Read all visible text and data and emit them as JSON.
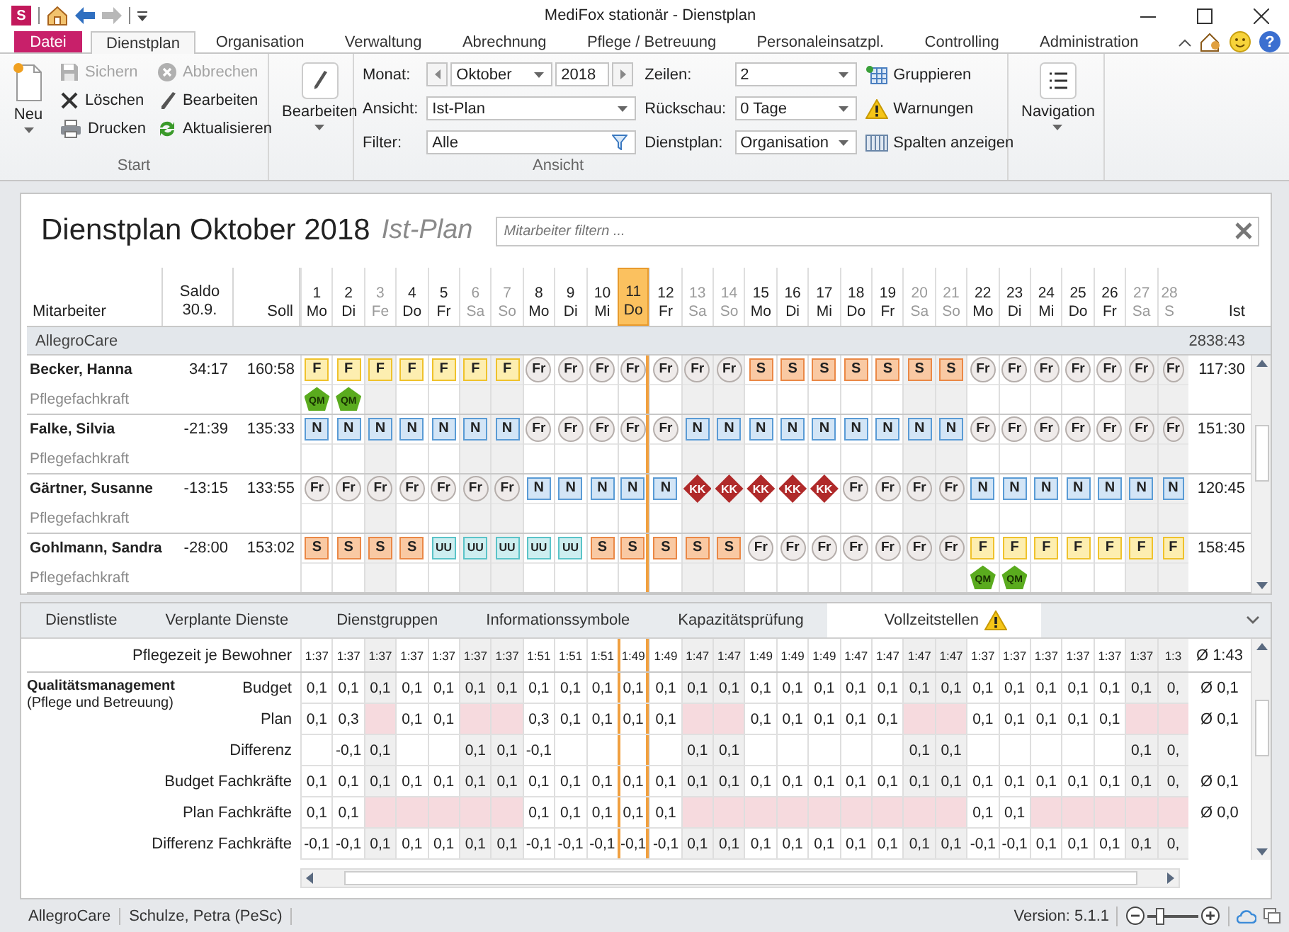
{
  "window": {
    "logo": "S",
    "title": "MediFox stationär - Dienstplan",
    "help": "?"
  },
  "ribbon_tabs": [
    {
      "label": "Datei",
      "kind": "file",
      "selected": false
    },
    {
      "label": "Dienstplan",
      "kind": "tab",
      "selected": true
    },
    {
      "label": "Organisation",
      "kind": "tab",
      "selected": false
    },
    {
      "label": "Verwaltung",
      "kind": "tab",
      "selected": false
    },
    {
      "label": "Abrechnung",
      "kind": "tab",
      "selected": false
    },
    {
      "label": "Pflege / Betreuung",
      "kind": "tab",
      "selected": false
    },
    {
      "label": "Personaleinsatzpl.",
      "kind": "tab",
      "selected": false
    },
    {
      "label": "Controlling",
      "kind": "tab",
      "selected": false
    },
    {
      "label": "Administration",
      "kind": "tab",
      "selected": false
    }
  ],
  "ribbon": {
    "start": {
      "label": "Start",
      "new": "Neu",
      "actions": [
        {
          "label": "Sichern",
          "kind": "save",
          "disabled": true
        },
        {
          "label": "Löschen",
          "kind": "delete",
          "disabled": false
        },
        {
          "label": "Drucken",
          "kind": "print",
          "disabled": false
        },
        {
          "label": "Abbrechen",
          "kind": "cancel",
          "disabled": true
        },
        {
          "label": "Bearbeiten",
          "kind": "edit",
          "disabled": false
        },
        {
          "label": "Aktualisieren",
          "kind": "refresh",
          "disabled": false
        }
      ]
    },
    "edit": {
      "label": "Bearbeiten"
    },
    "view": {
      "label": "Ansicht",
      "month_label": "Monat:",
      "month": "Oktober",
      "year": "2018",
      "view_label": "Ansicht:",
      "view_value": "Ist-Plan",
      "filter_label": "Filter:",
      "filter_value": "Alle",
      "rows_label": "Zeilen:",
      "rows_value": "2",
      "lookback_label": "Rückschau:",
      "lookback_value": "0 Tage",
      "plan_label": "Dienstplan:",
      "plan_value": "Organisation",
      "actions": [
        {
          "label": "Gruppieren",
          "kind": "group"
        },
        {
          "label": "Warnungen",
          "kind": "warning"
        },
        {
          "label": "Spalten anzeigen",
          "kind": "columns"
        }
      ]
    },
    "navigation": {
      "label": "Navigation"
    }
  },
  "plan": {
    "title": "Dienstplan Oktober 2018",
    "subtitle": "Ist-Plan",
    "filter_placeholder": "Mitarbeiter filtern ...",
    "employee_header": "Mitarbeiter",
    "saldo_header": "Saldo 30.9.",
    "soll_header": "Soll",
    "ist_header": "Ist",
    "days": [
      {
        "day": "1",
        "weekday": "Mo",
        "muted": false,
        "selected": false
      },
      {
        "day": "2",
        "weekday": "Di",
        "muted": false,
        "selected": false
      },
      {
        "day": "3",
        "weekday": "Fe",
        "muted": true,
        "selected": false
      },
      {
        "day": "4",
        "weekday": "Do",
        "muted": false,
        "selected": false
      },
      {
        "day": "5",
        "weekday": "Fr",
        "muted": false,
        "selected": false
      },
      {
        "day": "6",
        "weekday": "Sa",
        "muted": true,
        "selected": false
      },
      {
        "day": "7",
        "weekday": "So",
        "muted": true,
        "selected": false
      },
      {
        "day": "8",
        "weekday": "Mo",
        "muted": false,
        "selected": false
      },
      {
        "day": "9",
        "weekday": "Di",
        "muted": false,
        "selected": false
      },
      {
        "day": "10",
        "weekday": "Mi",
        "muted": false,
        "selected": false
      },
      {
        "day": "11",
        "weekday": "Do",
        "muted": false,
        "selected": true
      },
      {
        "day": "12",
        "weekday": "Fr",
        "muted": false,
        "selected": false
      },
      {
        "day": "13",
        "weekday": "Sa",
        "muted": true,
        "selected": false
      },
      {
        "day": "14",
        "weekday": "So",
        "muted": true,
        "selected": false
      },
      {
        "day": "15",
        "weekday": "Mo",
        "muted": false,
        "selected": false
      },
      {
        "day": "16",
        "weekday": "Di",
        "muted": false,
        "selected": false
      },
      {
        "day": "17",
        "weekday": "Mi",
        "muted": false,
        "selected": false
      },
      {
        "day": "18",
        "weekday": "Do",
        "muted": false,
        "selected": false
      },
      {
        "day": "19",
        "weekday": "Fr",
        "muted": false,
        "selected": false
      },
      {
        "day": "20",
        "weekday": "Sa",
        "muted": true,
        "selected": false
      },
      {
        "day": "21",
        "weekday": "So",
        "muted": true,
        "selected": false
      },
      {
        "day": "22",
        "weekday": "Mo",
        "muted": false,
        "selected": false
      },
      {
        "day": "23",
        "weekday": "Di",
        "muted": false,
        "selected": false
      },
      {
        "day": "24",
        "weekday": "Mi",
        "muted": false,
        "selected": false
      },
      {
        "day": "25",
        "weekday": "Do",
        "muted": false,
        "selected": false
      },
      {
        "day": "26",
        "weekday": "Fr",
        "muted": false,
        "selected": false
      },
      {
        "day": "27",
        "weekday": "Sa",
        "muted": true,
        "selected": false
      },
      {
        "day": "28",
        "weekday": "S",
        "muted": true,
        "selected": false
      }
    ],
    "group": {
      "name": "AllegroCare",
      "ist": "2838:43"
    },
    "employees": [
      {
        "name": "Becker, Hanna",
        "role": "Pflegefachkraft",
        "saldo": "34:17",
        "soll": "160:58",
        "ist": "117:30",
        "shifts": [
          {
            "code": "F",
            "kind": "early",
            "marker": "QM"
          },
          {
            "code": "F",
            "kind": "early",
            "marker": "QM"
          },
          {
            "code": "F",
            "kind": "early"
          },
          {
            "code": "F",
            "kind": "early"
          },
          {
            "code": "F",
            "kind": "early"
          },
          {
            "code": "F",
            "kind": "early"
          },
          {
            "code": "F",
            "kind": "early"
          },
          {
            "code": "Fr",
            "kind": "off"
          },
          {
            "code": "Fr",
            "kind": "off"
          },
          {
            "code": "Fr",
            "kind": "off"
          },
          {
            "code": "Fr",
            "kind": "off"
          },
          {
            "code": "Fr",
            "kind": "off"
          },
          {
            "code": "Fr",
            "kind": "off"
          },
          {
            "code": "Fr",
            "kind": "off"
          },
          {
            "code": "S",
            "kind": "late"
          },
          {
            "code": "S",
            "kind": "late"
          },
          {
            "code": "S",
            "kind": "late"
          },
          {
            "code": "S",
            "kind": "late"
          },
          {
            "code": "S",
            "kind": "late"
          },
          {
            "code": "S",
            "kind": "late"
          },
          {
            "code": "S",
            "kind": "late"
          },
          {
            "code": "Fr",
            "kind": "off"
          },
          {
            "code": "Fr",
            "kind": "off"
          },
          {
            "code": "Fr",
            "kind": "off"
          },
          {
            "code": "Fr",
            "kind": "off"
          },
          {
            "code": "Fr",
            "kind": "off"
          },
          {
            "code": "Fr",
            "kind": "off"
          },
          {
            "code": "Fr",
            "kind": "off"
          }
        ]
      },
      {
        "name": "Falke, Silvia",
        "role": "Pflegefachkraft",
        "saldo": "-21:39",
        "soll": "135:33",
        "ist": "151:30",
        "shifts": [
          {
            "code": "N",
            "kind": "night"
          },
          {
            "code": "N",
            "kind": "night"
          },
          {
            "code": "N",
            "kind": "night"
          },
          {
            "code": "N",
            "kind": "night"
          },
          {
            "code": "N",
            "kind": "night"
          },
          {
            "code": "N",
            "kind": "night"
          },
          {
            "code": "N",
            "kind": "night"
          },
          {
            "code": "Fr",
            "kind": "off"
          },
          {
            "code": "Fr",
            "kind": "off"
          },
          {
            "code": "Fr",
            "kind": "off"
          },
          {
            "code": "Fr",
            "kind": "off"
          },
          {
            "code": "Fr",
            "kind": "off"
          },
          {
            "code": "N",
            "kind": "night"
          },
          {
            "code": "N",
            "kind": "night"
          },
          {
            "code": "N",
            "kind": "night"
          },
          {
            "code": "N",
            "kind": "night"
          },
          {
            "code": "N",
            "kind": "night"
          },
          {
            "code": "N",
            "kind": "night"
          },
          {
            "code": "N",
            "kind": "night"
          },
          {
            "code": "N",
            "kind": "night"
          },
          {
            "code": "N",
            "kind": "night"
          },
          {
            "code": "Fr",
            "kind": "off"
          },
          {
            "code": "Fr",
            "kind": "off"
          },
          {
            "code": "Fr",
            "kind": "off"
          },
          {
            "code": "Fr",
            "kind": "off"
          },
          {
            "code": "Fr",
            "kind": "off"
          },
          {
            "code": "Fr",
            "kind": "off"
          },
          {
            "code": "Fr",
            "kind": "off"
          }
        ]
      },
      {
        "name": "Gärtner, Susanne",
        "role": "Pflegefachkraft",
        "saldo": "-13:15",
        "soll": "133:55",
        "ist": "120:45",
        "shifts": [
          {
            "code": "Fr",
            "kind": "off"
          },
          {
            "code": "Fr",
            "kind": "off"
          },
          {
            "code": "Fr",
            "kind": "off"
          },
          {
            "code": "Fr",
            "kind": "off"
          },
          {
            "code": "Fr",
            "kind": "off"
          },
          {
            "code": "Fr",
            "kind": "off"
          },
          {
            "code": "Fr",
            "kind": "off"
          },
          {
            "code": "N",
            "kind": "night"
          },
          {
            "code": "N",
            "kind": "night"
          },
          {
            "code": "N",
            "kind": "night"
          },
          {
            "code": "N",
            "kind": "night"
          },
          {
            "code": "N",
            "kind": "night"
          },
          {
            "code": "KK",
            "kind": "sick"
          },
          {
            "code": "KK",
            "kind": "sick"
          },
          {
            "code": "KK",
            "kind": "sick"
          },
          {
            "code": "KK",
            "kind": "sick"
          },
          {
            "code": "KK",
            "kind": "sick"
          },
          {
            "code": "Fr",
            "kind": "off"
          },
          {
            "code": "Fr",
            "kind": "off"
          },
          {
            "code": "Fr",
            "kind": "off"
          },
          {
            "code": "Fr",
            "kind": "off"
          },
          {
            "code": "N",
            "kind": "night"
          },
          {
            "code": "N",
            "kind": "night"
          },
          {
            "code": "N",
            "kind": "night"
          },
          {
            "code": "N",
            "kind": "night"
          },
          {
            "code": "N",
            "kind": "night"
          },
          {
            "code": "N",
            "kind": "night"
          },
          {
            "code": "N",
            "kind": "night"
          }
        ]
      },
      {
        "name": "Gohlmann, Sandra",
        "role": "Pflegefachkraft",
        "saldo": "-28:00",
        "soll": "153:02",
        "ist": "158:45",
        "shifts": [
          {
            "code": "S",
            "kind": "late"
          },
          {
            "code": "S",
            "kind": "late"
          },
          {
            "code": "S",
            "kind": "late"
          },
          {
            "code": "S",
            "kind": "late"
          },
          {
            "code": "UU",
            "kind": "leave"
          },
          {
            "code": "UU",
            "kind": "leave"
          },
          {
            "code": "UU",
            "kind": "leave"
          },
          {
            "code": "UU",
            "kind": "leave"
          },
          {
            "code": "UU",
            "kind": "leave"
          },
          {
            "code": "S",
            "kind": "late"
          },
          {
            "code": "S",
            "kind": "late"
          },
          {
            "code": "S",
            "kind": "late"
          },
          {
            "code": "S",
            "kind": "late"
          },
          {
            "code": "S",
            "kind": "late"
          },
          {
            "code": "Fr",
            "kind": "off"
          },
          {
            "code": "Fr",
            "kind": "off"
          },
          {
            "code": "Fr",
            "kind": "off"
          },
          {
            "code": "Fr",
            "kind": "off"
          },
          {
            "code": "Fr",
            "kind": "off"
          },
          {
            "code": "Fr",
            "kind": "off"
          },
          {
            "code": "Fr",
            "kind": "off"
          },
          {
            "code": "F",
            "kind": "early",
            "marker": "QM"
          },
          {
            "code": "F",
            "kind": "early",
            "marker": "QM"
          },
          {
            "code": "F",
            "kind": "early"
          },
          {
            "code": "F",
            "kind": "early"
          },
          {
            "code": "F",
            "kind": "early"
          },
          {
            "code": "F",
            "kind": "early"
          },
          {
            "code": "F",
            "kind": "early"
          }
        ]
      }
    ]
  },
  "bottom": {
    "tabs": [
      {
        "label": "Dienstliste",
        "selected": false,
        "warning": false
      },
      {
        "label": "Verplante Dienste",
        "selected": false,
        "warning": false
      },
      {
        "label": "Dienstgruppen",
        "selected": false,
        "warning": false
      },
      {
        "label": "Informationssymbole",
        "selected": false,
        "warning": false
      },
      {
        "label": "Kapazitätsprüfung",
        "selected": false,
        "warning": false
      },
      {
        "label": "Vollzeitstellen",
        "selected": true,
        "warning": true
      }
    ],
    "time_row": {
      "label": "Pflegezeit je Bewohner",
      "average": "Ø 1:43",
      "cells": [
        "1:37",
        "1:37",
        "1:37",
        "1:37",
        "1:37",
        "1:37",
        "1:37",
        "1:51",
        "1:51",
        "1:51",
        "1:49",
        "1:49",
        "1:47",
        "1:47",
        "1:49",
        "1:49",
        "1:49",
        "1:47",
        "1:47",
        "1:47",
        "1:47",
        "1:37",
        "1:37",
        "1:37",
        "1:37",
        "1:37",
        "1:37",
        "1:3"
      ]
    },
    "group": {
      "title": "Qualitätsmanagement",
      "subtitle": "(Pflege und Betreuung)",
      "rows": [
        {
          "label": "Budget",
          "shortfall": false,
          "average": "Ø 0,1",
          "cells": [
            "0,1",
            "0,1",
            "0,1",
            "0,1",
            "0,1",
            "0,1",
            "0,1",
            "0,1",
            "0,1",
            "0,1",
            "0,1",
            "0,1",
            "0,1",
            "0,1",
            "0,1",
            "0,1",
            "0,1",
            "0,1",
            "0,1",
            "0,1",
            "0,1",
            "0,1",
            "0,1",
            "0,1",
            "0,1",
            "0,1",
            "0,1",
            "0,"
          ]
        },
        {
          "label": "Plan",
          "shortfall": true,
          "average": "Ø 0,1",
          "cells": [
            "0,1",
            "0,3",
            null,
            "0,1",
            "0,1",
            null,
            null,
            "0,3",
            "0,1",
            "0,1",
            "0,1",
            "0,1",
            null,
            null,
            "0,1",
            "0,1",
            "0,1",
            "0,1",
            "0,1",
            null,
            null,
            "0,1",
            "0,1",
            "0,1",
            "0,1",
            "0,1",
            null,
            null
          ]
        },
        {
          "label": "Differenz",
          "shortfall": false,
          "cells": [
            null,
            "-0,1",
            "0,1",
            null,
            null,
            "0,1",
            "0,1",
            "-0,1",
            null,
            null,
            null,
            null,
            "0,1",
            "0,1",
            null,
            null,
            null,
            null,
            null,
            "0,1",
            "0,1",
            null,
            null,
            null,
            null,
            null,
            "0,1",
            "0,"
          ]
        },
        {
          "label": "Budget Fachkräfte",
          "shortfall": false,
          "average": "Ø 0,1",
          "cells": [
            "0,1",
            "0,1",
            "0,1",
            "0,1",
            "0,1",
            "0,1",
            "0,1",
            "0,1",
            "0,1",
            "0,1",
            "0,1",
            "0,1",
            "0,1",
            "0,1",
            "0,1",
            "0,1",
            "0,1",
            "0,1",
            "0,1",
            "0,1",
            "0,1",
            "0,1",
            "0,1",
            "0,1",
            "0,1",
            "0,1",
            "0,1",
            "0,"
          ]
        },
        {
          "label": "Plan Fachkräfte",
          "shortfall": true,
          "average": "Ø 0,0",
          "cells": [
            "0,1",
            "0,1",
            null,
            null,
            null,
            null,
            null,
            "0,1",
            "0,1",
            "0,1",
            "0,1",
            "0,1",
            null,
            null,
            null,
            null,
            null,
            null,
            null,
            null,
            null,
            "0,1",
            "0,1",
            null,
            null,
            null,
            null,
            null
          ]
        },
        {
          "label": "Differenz Fachkräfte",
          "shortfall": false,
          "cells": [
            "-0,1",
            "-0,1",
            "0,1",
            "0,1",
            "0,1",
            "0,1",
            "0,1",
            "-0,1",
            "-0,1",
            "-0,1",
            "-0,1",
            "-0,1",
            "0,1",
            "0,1",
            "0,1",
            "0,1",
            "0,1",
            "0,1",
            "0,1",
            "0,1",
            "0,1",
            "-0,1",
            "-0,1",
            "0,1",
            "0,1",
            "0,1",
            "0,1",
            "0,"
          ]
        }
      ]
    }
  },
  "status_bar": {
    "client": "AllegroCare",
    "user": "Schulze, Petra (PeSc)",
    "version": "Version: 5.1.1",
    "zoom": {
      "level": 0.2
    }
  }
}
